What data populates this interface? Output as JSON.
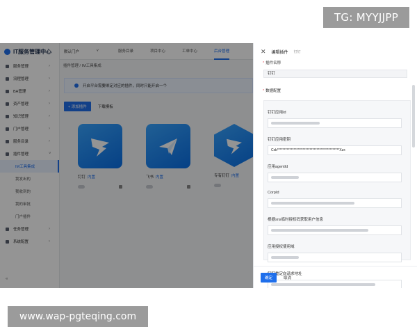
{
  "watermarks": {
    "top": "TG: MYYJJPP",
    "bottom": "www.wap-pgteqing.com"
  },
  "brand": {
    "name": "IT服务管理中心"
  },
  "sidebar": {
    "items": [
      "服务管理",
      "流程管理",
      "BA管理",
      "资产管理",
      "知识管理",
      "门户管理",
      "服务目录",
      "插件管理"
    ],
    "subitems": [
      "IM工具集成",
      "我发出的",
      "我收到的",
      "我的审批",
      "门户插件"
    ],
    "bottom_items": [
      "任务管理",
      "系统配置"
    ],
    "collapse": "«"
  },
  "topbar": {
    "portal": "默认门户",
    "tabs": [
      "服务目录",
      "项目中心",
      "工单中心",
      "后台管理"
    ]
  },
  "breadcrumb": "插件管理 / IM工具集成",
  "notice": "开启平台需要绑定对应的插件，同时只能开启一个",
  "actions": {
    "add": "+ 添加插件",
    "download": "下载模板"
  },
  "cards": [
    {
      "name": "钉钉",
      "tag": "内置"
    },
    {
      "name": "飞书",
      "tag": "内置"
    },
    {
      "name": "专有钉钉",
      "tag": "内置"
    }
  ],
  "drawer": {
    "title": "编辑插件",
    "subtitle": "钉钉",
    "name_label": "插件名称",
    "name_value": "钉钉",
    "config_label": "数据配置",
    "fields": [
      {
        "label": "钉钉应用Id",
        "value": ""
      },
      {
        "label": "钉钉应用密钥",
        "value": "Cxb**********************************************Xzx"
      },
      {
        "label": "应用agentId",
        "value": ""
      },
      {
        "label": "CorpId",
        "value": ""
      },
      {
        "label": "根据sns临时授权码获取用户信息",
        "value": ""
      },
      {
        "label": "应用授权使用域",
        "value": ""
      },
      {
        "label": "钉钉重定向请求地址",
        "value": ""
      }
    ],
    "ok": "确定",
    "cancel": "取消"
  }
}
